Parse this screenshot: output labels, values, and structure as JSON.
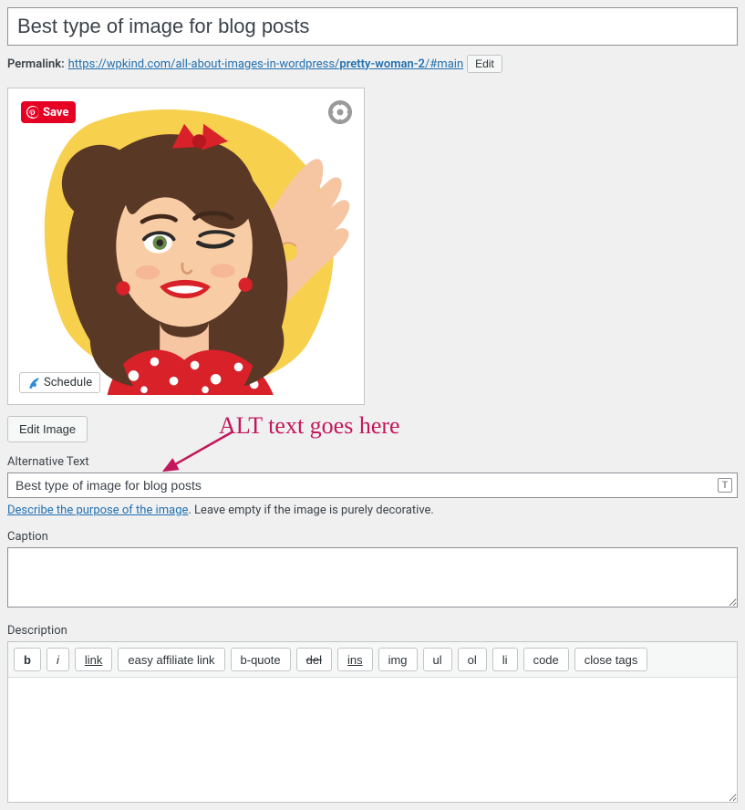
{
  "title_value": "Best type of image for blog posts",
  "permalink": {
    "label": "Permalink:",
    "url_text": "https://wpkind.com/all-about-images-in-wordpress/",
    "slug": "pretty-woman-2",
    "hash": "/#main",
    "edit_label": "Edit"
  },
  "overlay": {
    "save_label": "Save",
    "schedule_label": "Schedule"
  },
  "edit_image_label": "Edit Image",
  "annotation_text": "ALT text goes here",
  "alt": {
    "label": "Alternative Text",
    "value": "Best type of image for blog posts",
    "help_link_text": "Describe the purpose of the image",
    "help_rest": ". Leave empty if the image is purely decorative."
  },
  "caption": {
    "label": "Caption",
    "value": ""
  },
  "description": {
    "label": "Description",
    "buttons": [
      "b",
      "i",
      "link",
      "easy affiliate link",
      "b-quote",
      "del",
      "ins",
      "img",
      "ul",
      "ol",
      "li",
      "code",
      "close tags"
    ],
    "value": ""
  }
}
